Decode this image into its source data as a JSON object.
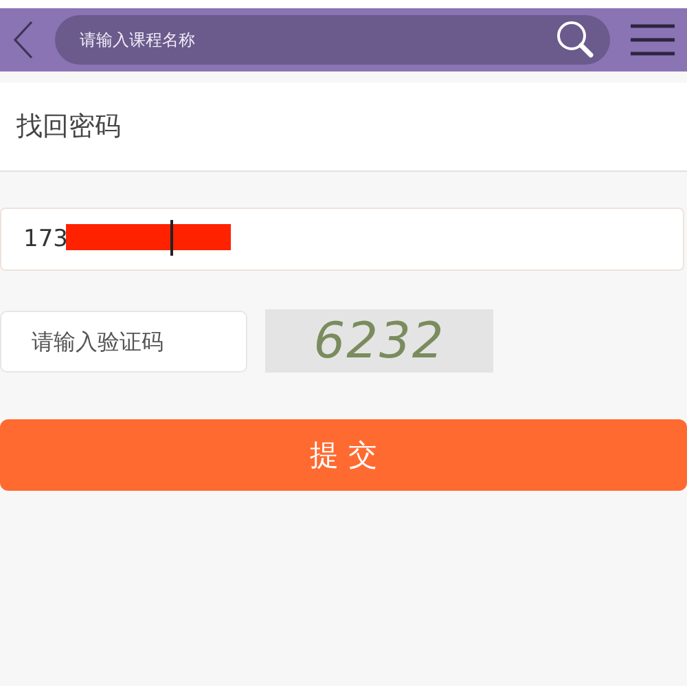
{
  "header": {
    "search": {
      "placeholder": "请输入课程名称"
    }
  },
  "page_title": "找回密码",
  "form": {
    "phone": {
      "value": "173",
      "redacted": true
    },
    "captcha": {
      "placeholder": "请输入验证码",
      "code": "6232"
    },
    "submit": "提 交"
  }
}
